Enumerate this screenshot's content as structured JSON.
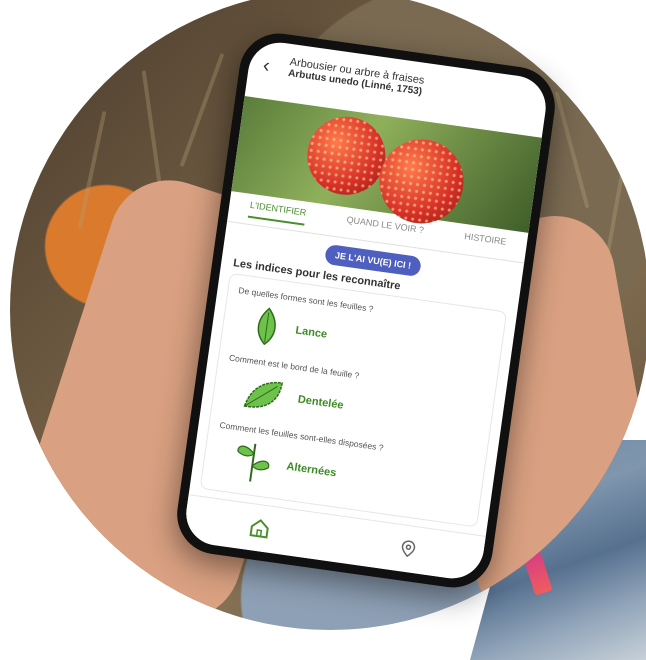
{
  "header": {
    "title": "Arbousier ou arbre à fraises",
    "subtitle": "Arbutus unedo (Linné, 1753)"
  },
  "tabs": [
    {
      "label": "L'IDENTIFIER",
      "active": true
    },
    {
      "label": "QUAND LE VOIR ?",
      "active": false
    },
    {
      "label": "HISTOIRE",
      "active": false
    }
  ],
  "seen_button": "JE L'AI VU(E) ICI !",
  "section_title": "Les indices pour les reconnaître",
  "clues": [
    {
      "question": "De quelles formes sont les feuilles ?",
      "answer": "Lance",
      "icon": "lance-leaf-icon"
    },
    {
      "question": "Comment est le bord de la feuille ?",
      "answer": "Dentelée",
      "icon": "serrated-leaf-icon"
    },
    {
      "question": "Comment les feuilles sont-elles disposées ?",
      "answer": "Alternées",
      "icon": "alternate-leaves-icon"
    }
  ],
  "bottom_nav": [
    {
      "icon": "home-icon",
      "active": true
    },
    {
      "icon": "map-pin-icon",
      "active": false
    }
  ],
  "colors": {
    "accent": "#4b8f2c",
    "button": "#4e5fbf"
  }
}
